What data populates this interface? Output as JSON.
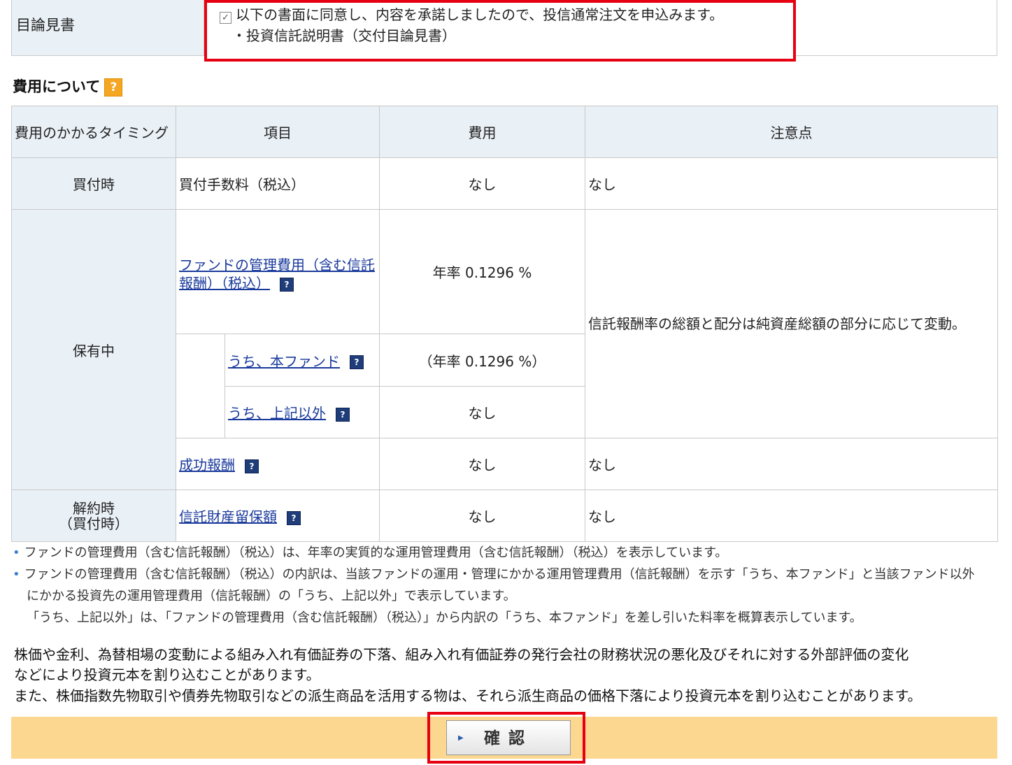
{
  "prospectus": {
    "label": "目論見書",
    "consent_text": "以下の書面に同意し、内容を承諾しましたので、投信通常注文を申込みます。",
    "document": "・投資信託説明書（交付目論見書）"
  },
  "fees": {
    "title": "費用について",
    "help": "?",
    "headers": [
      "費用のかかるタイミング",
      "項目",
      "費用",
      "注意点"
    ],
    "rows": {
      "buy_timing": "買付時",
      "buy_item": "買付手数料（税込）",
      "buy_fee": "なし",
      "buy_note": "なし",
      "hold_timing": "保有中",
      "mgmt_item": "ファンドの管理費用（含む信託報酬）（税込）",
      "mgmt_fee": "年率 0.1296 %",
      "mgmt_note": "信託報酬率の総額と配分は純資産総額の部分に応じて変動。",
      "fund_item": "うち、本ファンド",
      "fund_fee": "（年率 0.1296 %）",
      "other_item": "うち、上記以外",
      "other_fee": "なし",
      "success_item": "成功報酬",
      "success_fee": "なし",
      "success_note": "なし",
      "cancel_timing": "解約時\n（買付時）",
      "retention_item": "信託財産留保額",
      "retention_fee": "なし",
      "retention_note": "なし"
    }
  },
  "notes": [
    "ファンドの管理費用（含む信託報酬）（税込）は、年率の実質的な運用管理費用（含む信託報酬）（税込）を表示しています。",
    "ファンドの管理費用（含む信託報酬）（税込）の内訳は、当該ファンドの運用・管理にかかる運用管理費用（信託報酬）を示す「うち、本ファンド」と当該ファンド以外",
    "にかかる投資先の運用管理費用（信託報酬）の「うち、上記以外」で表示しています。",
    "「うち、上記以外」は、「ファンドの管理費用（含む信託報酬）（税込）」から内訳の「うち、本ファンド」を差し引いた料率を概算表示しています。"
  ],
  "risk": [
    "株価や金利、為替相場の変動による組み入れ有価証券の下落、組み入れ有価証券の発行会社の財務状況の悪化及びそれに対する外部評価の変化",
    "などにより投資元本を割り込むことがあります。",
    "また、株価指数先物取引や債券先物取引などの派生商品を活用する物は、それら派生商品の価格下落により投資元本を割り込むことがあります。"
  ],
  "confirm": {
    "arrow": "▶",
    "label": "確認"
  },
  "colors": {
    "highlight": "#e60012",
    "header_bg": "#e9f0f6",
    "button_bar": "#fbd790",
    "link": "#1a3a9c"
  }
}
